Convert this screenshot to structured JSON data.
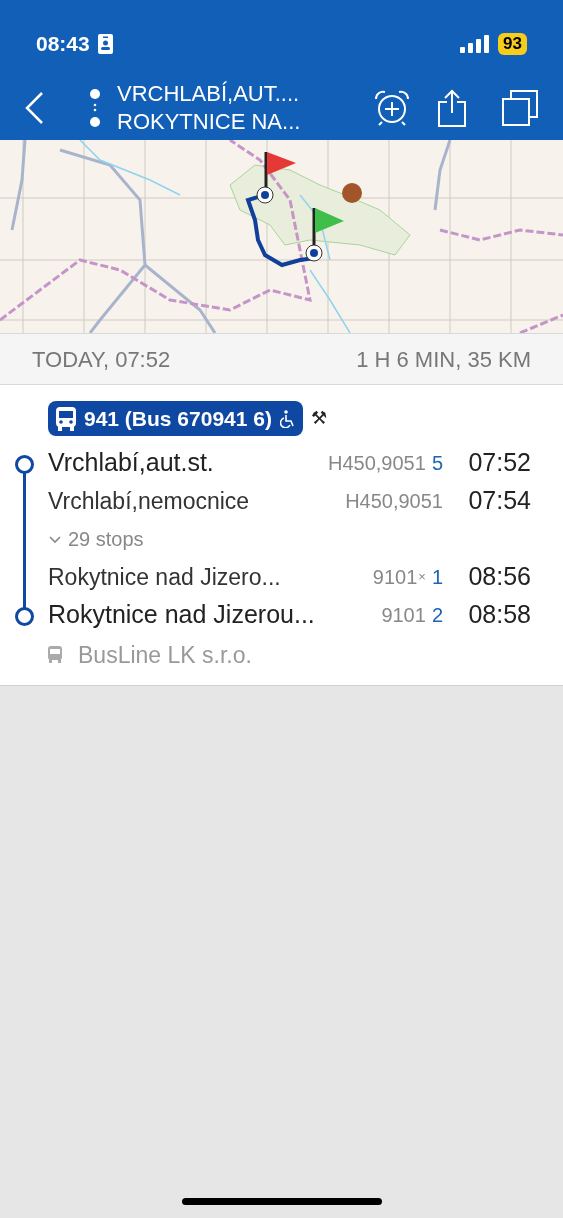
{
  "status_bar": {
    "time": "08:43",
    "battery": "93"
  },
  "nav": {
    "from": "VRCHLABÍ,AUT....",
    "to": "ROKYTNICE NA..."
  },
  "summary": {
    "date": "TODAY, 07:52",
    "duration": "1 H 6 MIN, 35 KM"
  },
  "line": {
    "label": "941 (Bus 670941 6)",
    "wheelchair": true,
    "extra_symbol": "⚒"
  },
  "stops": [
    {
      "kind": "terminal",
      "name": "Vrchlabí,aut.st.",
      "platform": "H450,9051",
      "track": "5",
      "time": "07:52"
    },
    {
      "kind": "intermediate",
      "name": "Vrchlabí,nemocnice",
      "platform": "H450,9051",
      "time": "07:54"
    },
    {
      "kind": "collapsed",
      "label": "29 stops",
      "expanded": false
    },
    {
      "kind": "intermediate",
      "name": "Rokytnice nad Jizero...",
      "platform": "9101",
      "platform_note": "×",
      "track": "1",
      "time": "08:56"
    },
    {
      "kind": "terminal",
      "name": "Rokytnice nad Jizerou...",
      "platform": "9101",
      "track": "2",
      "time": "08:58"
    }
  ],
  "operator": "BusLine LK s.r.o."
}
